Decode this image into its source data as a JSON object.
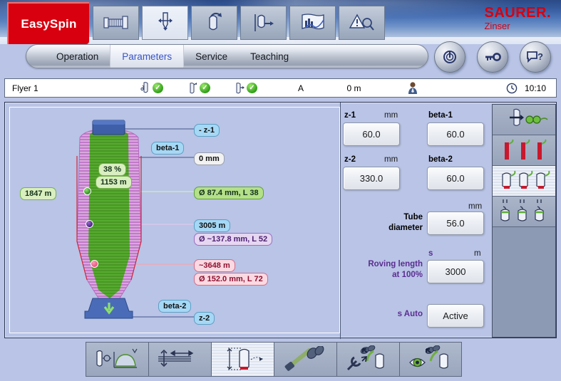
{
  "brand": {
    "logo_label": "EasySpin",
    "company": "SAURER.",
    "company_sub": "Zinser"
  },
  "toolbar": {
    "icons": [
      {
        "name": "machine-overview-icon",
        "selected": false
      },
      {
        "name": "spindle-drive-icon",
        "selected": true
      },
      {
        "name": "bobbin-rotate-icon",
        "selected": false
      },
      {
        "name": "bobbin-doff-icon",
        "selected": false
      },
      {
        "name": "production-chart-icon",
        "selected": false
      },
      {
        "name": "alarm-inspect-icon",
        "selected": false
      }
    ]
  },
  "nav": {
    "tabs": [
      {
        "label": "Operation",
        "active": false
      },
      {
        "label": "Parameters",
        "active": true
      },
      {
        "label": "Service",
        "active": false
      },
      {
        "label": "Teaching",
        "active": false
      }
    ]
  },
  "round_buttons": [
    {
      "name": "power-button",
      "glyph": "power-icon"
    },
    {
      "name": "key-access-button",
      "glyph": "key-icon"
    },
    {
      "name": "help-button",
      "glyph": "help-icon"
    }
  ],
  "status": {
    "machine": "Flyer 1",
    "indicators": [
      {
        "name": "bobbin-status-1",
        "state": "ok"
      },
      {
        "name": "bobbin-status-2",
        "state": "ok"
      },
      {
        "name": "bobbin-status-3",
        "state": "ok"
      }
    ],
    "mode": "A",
    "length": "0 m",
    "operator_icon": "operator-icon",
    "clock_icon": "clock-icon",
    "time": "10:10"
  },
  "diagram": {
    "labels": {
      "z1": "- z-1",
      "beta1": "beta-1",
      "zero_mm": "0 mm",
      "fill_percent": "38 %",
      "fill_length": "1153 m",
      "remaining": "1847 m",
      "measure_green": "Ø 87.4 mm,  L 38",
      "measure_violet_len": "3005 m",
      "measure_violet_dia": "Ø ~137.8 mm,  L 52",
      "measure_pink_len": "~3648 m",
      "measure_pink_dia": "Ø 152.0 mm,  L 72",
      "beta2": "beta-2",
      "z2": "z-2"
    },
    "colors": {
      "fill": "#4ca32b",
      "wound": "#d9a8de",
      "cap": "#3f5fa8",
      "base": "#4a6cb8",
      "marker_green": "#2f8f1e",
      "marker_violet": "#5b2d91",
      "marker_pink": "#e4567c"
    }
  },
  "parameters": {
    "z1": {
      "label": "z-1",
      "unit": "mm",
      "value": "60.0"
    },
    "z2": {
      "label": "z-2",
      "unit": "mm",
      "value": "330.0"
    },
    "beta1": {
      "label": "beta-1",
      "unit": "",
      "value": "60.0"
    },
    "beta2": {
      "label": "beta-2",
      "unit": "",
      "value": "60.0"
    },
    "tube_diameter": {
      "label": "Tube\ndiameter",
      "label_l1": "Tube",
      "label_l2": "diameter",
      "unit": "mm",
      "value": "56.0"
    },
    "roving_length": {
      "label_l1": "Roving length",
      "label_l2": "at 100%",
      "unit_s": "s",
      "unit": "m",
      "value": "3000"
    },
    "s_auto": {
      "label": "s Auto",
      "value": "Active"
    }
  },
  "right_icons": [
    {
      "name": "spindle-speed-icon",
      "selected": false
    },
    {
      "name": "tube-empty-icon",
      "selected": false
    },
    {
      "name": "bobbin-full-icon",
      "selected": true
    },
    {
      "name": "bobbin-doff-group-icon",
      "selected": false
    }
  ],
  "bottom_tools": [
    {
      "name": "build-profile-icon",
      "selected": false
    },
    {
      "name": "layer-traverse-icon",
      "selected": false
    },
    {
      "name": "bobbin-geometry-icon",
      "selected": true
    },
    {
      "name": "creel-icon",
      "selected": false
    },
    {
      "name": "maintenance-icon",
      "selected": false
    },
    {
      "name": "visual-inspect-icon",
      "selected": false
    }
  ]
}
